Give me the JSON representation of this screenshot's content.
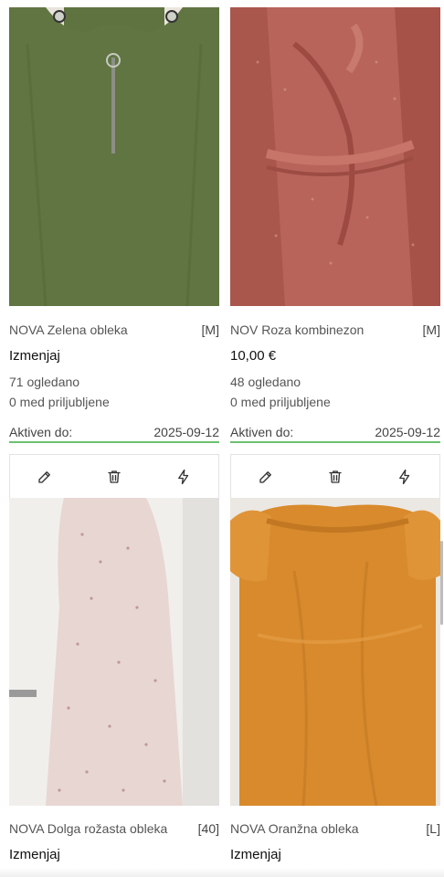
{
  "listings": [
    {
      "title": "NOVA Zelena obleka",
      "size": "[M]",
      "price": "Izmenjaj",
      "views": "71 ogledano",
      "favorites": "0 med priljubljene",
      "active_label": "Aktiven do:",
      "active_date": "2025-09-12",
      "image": "green-sleeveless-dress-photo"
    },
    {
      "title": "NOV Roza kombinezon",
      "size": "[M]",
      "price": "10,00 €",
      "views": "48 ogledano",
      "favorites": "0 med priljubljene",
      "active_label": "Aktiven do:",
      "active_date": "2025-09-12",
      "image": "pink-ruffle-jumpsuit-photo"
    },
    {
      "title": "NOVA Dolga rožasta obleka",
      "size": "[40]",
      "price": "Izmenjaj",
      "image": "long-floral-dress-photo"
    },
    {
      "title": "NOVA Oranžna obleka",
      "size": "[L]",
      "price": "Izmenjaj",
      "image": "orange-dress-photo"
    }
  ],
  "icons": {
    "edit": "pencil-icon",
    "delete": "trash-icon",
    "boost": "lightning-icon"
  },
  "colors": {
    "active_underline": "#6cc070",
    "green_dress": "#5f7340",
    "pink_jumpsuit": "#b8645a",
    "floral_dress": "#e8d6d2",
    "orange_dress": "#d88a2c"
  }
}
